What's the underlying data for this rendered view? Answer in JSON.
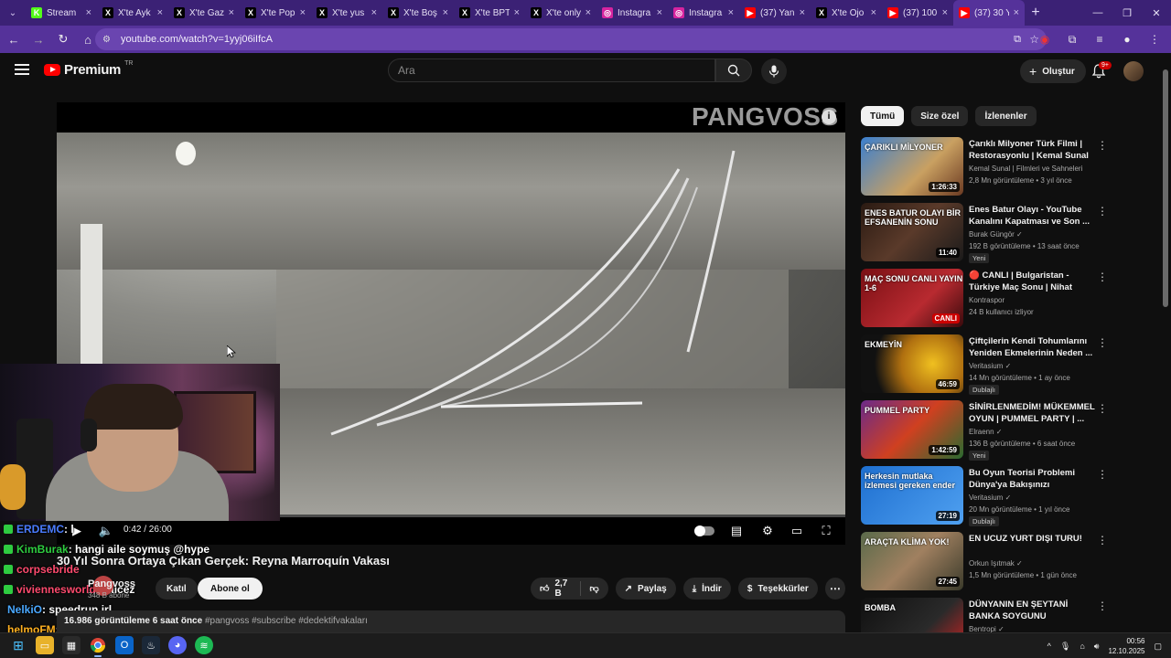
{
  "browser": {
    "tabs": [
      {
        "label": "Stream",
        "fav": "K",
        "fav_color": "#53fc18",
        "active": false
      },
      {
        "label": "X'te Ayk",
        "fav": "X",
        "fav_color": "#000000",
        "active": false
      },
      {
        "label": "X'te Gaz",
        "fav": "X",
        "fav_color": "#000000",
        "active": false
      },
      {
        "label": "X'te Pop",
        "fav": "X",
        "fav_color": "#000000",
        "active": false
      },
      {
        "label": "X'te yus",
        "fav": "X",
        "fav_color": "#000000",
        "active": false
      },
      {
        "label": "X'te Boş",
        "fav": "X",
        "fav_color": "#000000",
        "active": false
      },
      {
        "label": "X'te BPT",
        "fav": "X",
        "fav_color": "#000000",
        "active": false
      },
      {
        "label": "X'te only",
        "fav": "X",
        "fav_color": "#000000",
        "active": false
      },
      {
        "label": "Instagra",
        "fav": "◎",
        "fav_color": "#d6249f",
        "active": false
      },
      {
        "label": "Instagra",
        "fav": "◎",
        "fav_color": "#d6249f",
        "active": false
      },
      {
        "label": "(37) Yan",
        "fav": "▶",
        "fav_color": "#ff0000",
        "active": false
      },
      {
        "label": "X'te Ojo",
        "fav": "X",
        "fav_color": "#000000",
        "active": false
      },
      {
        "label": "(37) 100",
        "fav": "▶",
        "fav_color": "#ff0000",
        "active": false
      },
      {
        "label": "(37) 30 Y",
        "fav": "▶",
        "fav_color": "#ff0000",
        "active": true
      }
    ],
    "url": "youtube.com/watch?v=1yyj06iIfcA"
  },
  "youtube": {
    "brand": "Premium",
    "country": "TR",
    "search_placeholder": "Ara",
    "create_label": "Oluştur",
    "notif_count": "9+"
  },
  "player": {
    "watermark": "PANGVOSS",
    "time": "0:42 / 26:00",
    "progress": 0.027
  },
  "video": {
    "title": "30 Yıl Sonra Ortaya Çıkan Gerçek: Reyna Marroquín Vakası",
    "channel": "Pangvoss",
    "subs": "348 B abone",
    "join_label": "Katıl",
    "subscribe_label": "Abone ol",
    "likes": "2,7 B",
    "share_label": "Paylaş",
    "download_label": "İndir",
    "thanks_label": "Teşekkürler",
    "views_date": "16.986 görüntüleme  6 saat önce",
    "tags": "#pangvoss #subscribe #dedektifvakaları"
  },
  "chat": [
    {
      "user": "ERDEMC",
      "msg": ": l",
      "color": "#4a7cff",
      "badge": "#2ecc40"
    },
    {
      "user": "KimBurak",
      "msg": ": hangi aile soymuş @hype",
      "color": "#2ecc40",
      "badge": "#2ecc40"
    },
    {
      "user": "corpsebride",
      "msg": "",
      "color": "#ff4b6e",
      "badge": "#2ecc40"
    },
    {
      "user": "viviennesworld",
      "msg": ": izlicez",
      "color": "#ff4b6e",
      "badge": "#2ecc40"
    },
    {
      "user": "NelkiO",
      "msg": ": speedrun irl",
      "color": "#4aa8ff",
      "badge": ""
    },
    {
      "user": "helmoFM",
      "msg": ": la reddit",
      "color": "#ffb020",
      "badge": ""
    }
  ],
  "chips": [
    "Tümü",
    "Size özel",
    "İzlenenler"
  ],
  "recommendations": [
    {
      "title": "Çarıklı Milyoner Türk Filmi | Restorasyonlu | Kemal Sunal ...",
      "channel": "Kemal Sunal | Filmleri ve Sahneleri",
      "meta": "2,8 Mn görüntüleme • 3 yıl önce",
      "duration": "1:26:33",
      "tag": "",
      "thumb_text": "ÇARIKLI MİLYONER",
      "thumb_bg": "linear-gradient(135deg,#3a7fd0,#c9a061 60%,#6b3a22)"
    },
    {
      "title": "Enes Batur Olayı - YouTube Kanalını Kapatması ve Son ...",
      "channel": "Burak Güngör ✓",
      "meta": "192 B görüntüleme • 13 saat önce",
      "duration": "11:40",
      "tag": "Yeni",
      "thumb_text": "ENES BATUR OLAYI BİR EFSANENİN SONU",
      "thumb_bg": "linear-gradient(135deg,#2a1a12,#5a3a2a 50%,#1a1a1a)"
    },
    {
      "title": "🔴 CANLI | Bulgaristan - Türkiye Maç Sonu | Nihat Kahveci, Neb...",
      "channel": "Kontraspor",
      "meta": "24 B kullanıcı izliyor",
      "duration": "CANLI",
      "tag": "",
      "thumb_text": "MAÇ SONU CANLI YAYIN 1-6",
      "thumb_bg": "linear-gradient(135deg,#7a0f14,#b82a30 60%,#3a0a0c)"
    },
    {
      "title": "Çiftçilerin Kendi Tohumlarını Yeniden Ekmelerinin Neden ...",
      "channel": "Veritasium ✓",
      "meta": "14 Mn görüntüleme • 1 ay önce",
      "duration": "46:59",
      "tag": "Dublajlı",
      "thumb_text": "EKMEYİN",
      "thumb_bg": "radial-gradient(circle at 70% 50%,#f0c020,#b07010 40%,#111 75%)"
    },
    {
      "title": "SİNİRLENMEDİM! MÜKEMMEL OYUN | PUMMEL PARTY | ...",
      "channel": "Elraenn ✓",
      "meta": "136 B görüntüleme • 6 saat önce",
      "duration": "1:42:59",
      "tag": "Yeni",
      "thumb_text": "PUMMEL PARTY",
      "thumb_bg": "linear-gradient(135deg,#6a2a8a,#d04020 50%,#2a6a30)"
    },
    {
      "title": "Bu Oyun Teorisi Problemi Dünya'ya Bakışınızı Değiştirecek",
      "channel": "Veritasium ✓",
      "meta": "20 Mn görüntüleme • 1 yıl önce",
      "duration": "27:19",
      "tag": "Dublajlı",
      "thumb_text": "Herkesin mutlaka izlemesi gereken ender",
      "thumb_bg": "linear-gradient(135deg,#1e6fd0,#4fa0f0)"
    },
    {
      "title": "EN UCUZ YURT DIŞI TURU!",
      "channel": "Orkun Işıtmak ✓",
      "meta": "1,5 Mn görüntüleme • 1 gün önce",
      "duration": "27:45",
      "tag": "",
      "thumb_text": "ARAÇTA KLİMA YOK!",
      "thumb_bg": "linear-gradient(135deg,#5a6a4a,#a08060 50%,#3a3a2a)"
    },
    {
      "title": "DÜNYANIN EN ŞEYTANİ BANKA SOYGUNU",
      "channel": "Bentropi ✓",
      "meta": "",
      "duration": "",
      "tag": "",
      "thumb_text": "BOMBA",
      "thumb_bg": "linear-gradient(135deg,#101010,#2a2a2a 60%,#c22 100%)"
    }
  ],
  "taskbar": {
    "time": "00:56",
    "date": "12.10.2025"
  }
}
